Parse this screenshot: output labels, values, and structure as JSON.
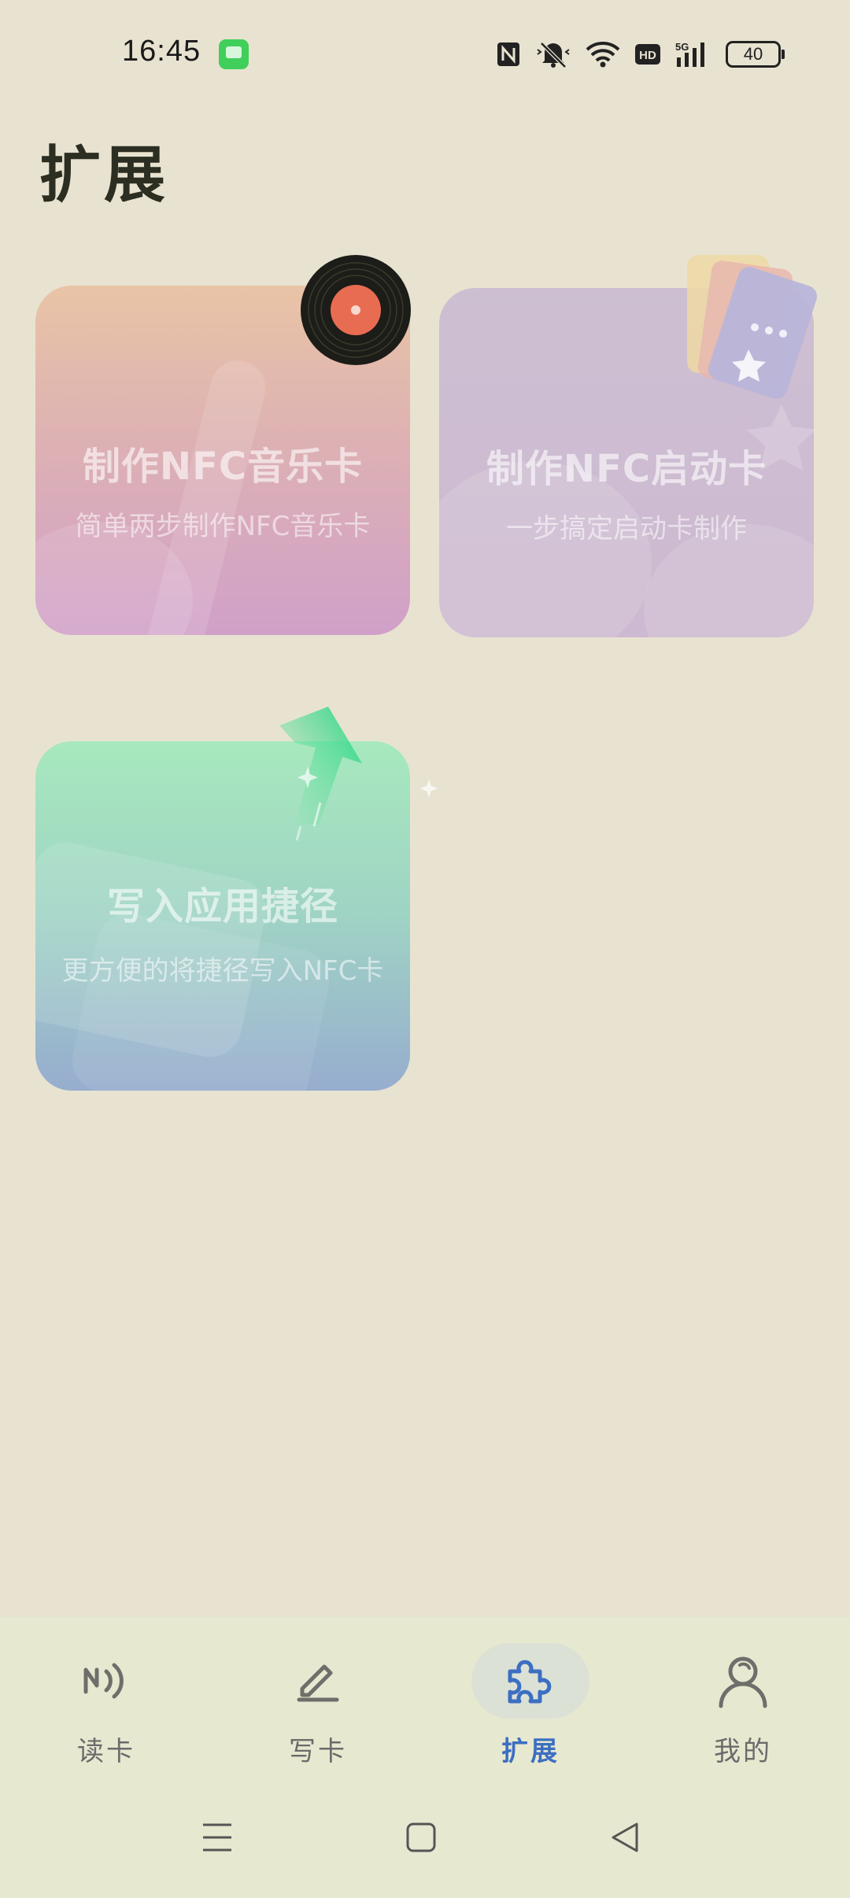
{
  "status_bar": {
    "time": "16:45",
    "battery": "40",
    "icons": [
      "messages-app-icon",
      "nfc-icon",
      "mute-icon",
      "wifi-icon",
      "hd-icon",
      "5g-signal-icon",
      "battery-icon"
    ]
  },
  "page": {
    "title": "扩展"
  },
  "cards": [
    {
      "title": "制作NFC音乐卡",
      "subtitle": "简单两步制作NFC音乐卡",
      "icon": "vinyl-record-icon"
    },
    {
      "title": "制作NFC启动卡",
      "subtitle": "一步搞定启动卡制作",
      "icon": "launch-cards-icon"
    },
    {
      "title": "写入应用捷径",
      "subtitle": "更方便的将捷径写入NFC卡",
      "icon": "arrow-up-icon"
    }
  ],
  "bottom_nav": {
    "items": [
      {
        "label": "读卡",
        "icon": "nfc-read-icon",
        "active": false
      },
      {
        "label": "写卡",
        "icon": "pencil-icon",
        "active": false
      },
      {
        "label": "扩展",
        "icon": "puzzle-icon",
        "active": true
      },
      {
        "label": "我的",
        "icon": "person-icon",
        "active": false
      }
    ]
  },
  "colors": {
    "accent": "#3c6fc2",
    "background": "#E8E3D0",
    "title": "#2c2e22"
  }
}
